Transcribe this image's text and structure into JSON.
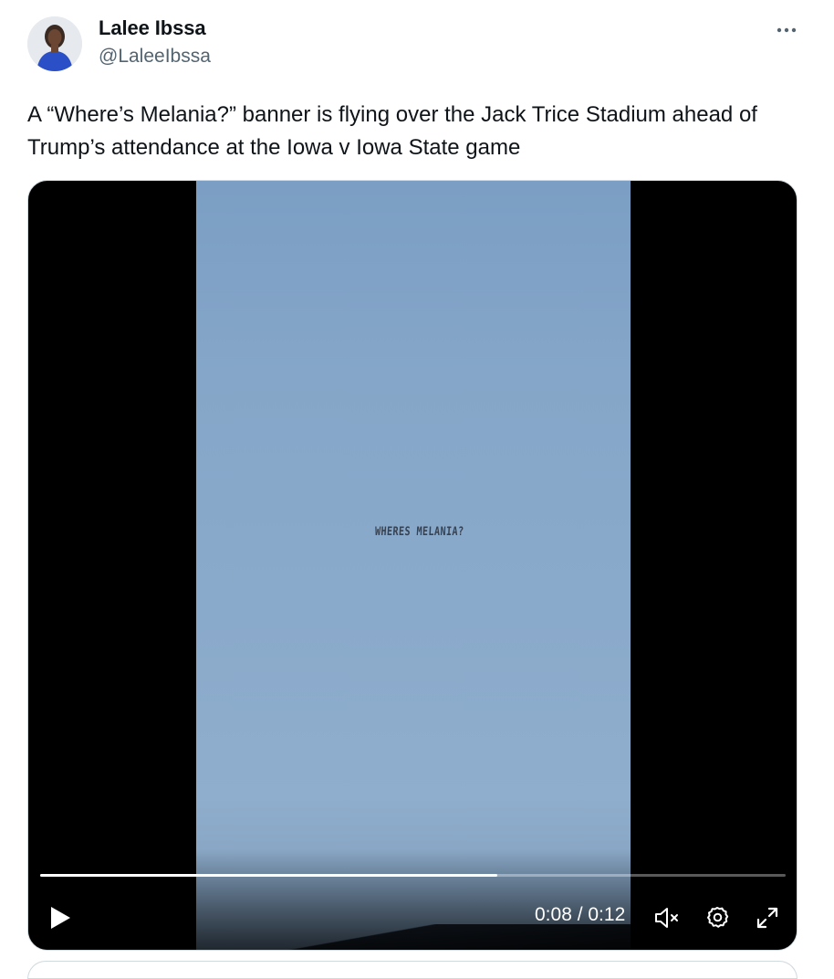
{
  "author": {
    "name": "Lalee Ibssa",
    "handle": "@LaleeIbssa"
  },
  "tweet": {
    "text": "A “Where’s Melania?” banner is flying over the Jack Trice Stadium ahead of Trump’s attendance at the Iowa v Iowa State game"
  },
  "media": {
    "banner_text": "WHERES MELANIA?",
    "player": {
      "current_time": "0:08",
      "duration": "0:12",
      "time_display": "0:08 / 0:12",
      "progress_fraction": 0.613,
      "muted": true
    }
  },
  "icons": {
    "more": "more-horizontal-icon",
    "play": "play-icon",
    "mute": "volume-muted-icon",
    "settings": "gear-icon",
    "fullscreen": "expand-icon"
  },
  "colors": {
    "text_primary": "#0f1419",
    "text_secondary": "#536471",
    "border": "#cfd9de",
    "sky": "#85a6c8"
  }
}
